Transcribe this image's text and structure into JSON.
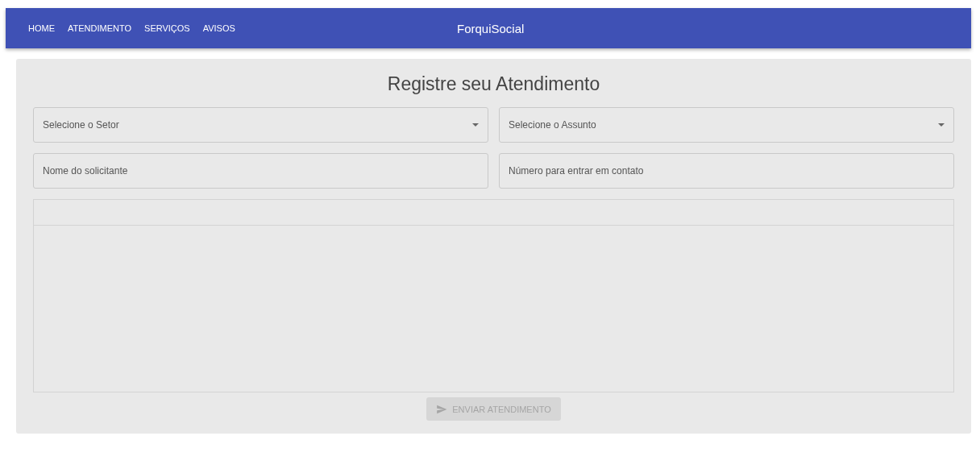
{
  "navbar": {
    "links": [
      {
        "label": "HOME"
      },
      {
        "label": "ATENDIMENTO"
      },
      {
        "label": "SERVIÇOS"
      },
      {
        "label": "AVISOS"
      }
    ],
    "brand": "ForquiSocial"
  },
  "form": {
    "title": "Registre seu Atendimento",
    "fields": [
      {
        "kind": "select",
        "placeholder": "Selecione o Setor"
      },
      {
        "kind": "select",
        "placeholder": "Selecione o Assunto"
      },
      {
        "kind": "text",
        "placeholder": "Nome do solicitante"
      },
      {
        "kind": "text",
        "placeholder": "Número para entrar em contato"
      }
    ],
    "submit": {
      "label": "ENVIAR ATENDIMENTO",
      "disabled": true
    }
  }
}
